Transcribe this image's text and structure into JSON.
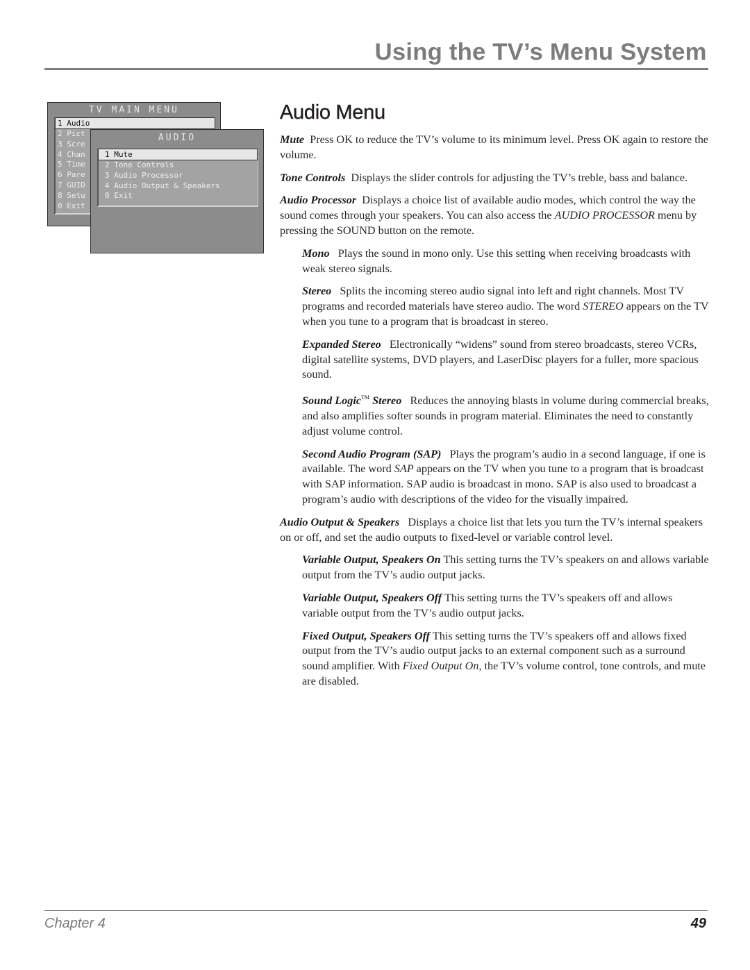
{
  "header": {
    "title": "Using the TV’s Menu System"
  },
  "tv_menu": {
    "main_menu": {
      "title": "TV MAIN MENU",
      "items": [
        "1 Audio",
        "2 Pict",
        "3 Scre",
        "4 Chan",
        "5 Time",
        "6 Pare",
        "7 GUID",
        "8 Setu",
        "0 Exit"
      ],
      "selected_index": 0
    },
    "audio_menu": {
      "title": "AUDIO",
      "items": [
        "1 Mute",
        "2 Tone Controls",
        "3 Audio Processor",
        "4 Audio Output & Speakers",
        "0 Exit"
      ],
      "selected_index": 0
    }
  },
  "section": {
    "title": "Audio Menu",
    "paragraphs": [
      {
        "term": "Mute",
        "text": "Press OK to reduce the TV’s volume to its minimum level. Press OK again to restore the volume."
      },
      {
        "term": "Tone Controls",
        "text": "Displays the slider controls for adjusting the TV’s treble, bass and balance."
      },
      {
        "term": "Audio Processor",
        "text_before": "Displays a choice list of available audio modes, which control the way the sound comes through your speakers. You can also access the ",
        "italic": "AUDIO PROCESSOR",
        "text_after": " menu by pressing the SOUND button on the remote."
      },
      {
        "term": "Mono",
        "text": "Plays the sound in mono only. Use this setting when receiving broadcasts with weak stereo signals."
      },
      {
        "term": "Stereo",
        "text_before": "Splits the incoming stereo audio signal into left and right channels. Most TV programs and recorded materials have stereo audio. The word ",
        "italic": "STEREO",
        "text_after": " appears on the TV when you tune to a program that is broadcast in stereo."
      },
      {
        "term": "Expanded Stereo",
        "text": "Electronically “widens” sound from stereo broadcasts, stereo VCRs, digital satellite systems, DVD players, and LaserDisc players for a fuller, more spacious sound."
      },
      {
        "term_a": "Sound Logic",
        "tm": "TM",
        "term_b": " Stereo",
        "text": "Reduces the annoying blasts in volume during commercial breaks, and also amplifies softer sounds in program material. Eliminates the need to constantly adjust volume control."
      },
      {
        "term": "Second Audio Program (SAP)",
        "text_before": "Plays the program’s audio in a second language, if one is available. The word ",
        "italic": "SAP",
        "text_after": " appears on the TV when you tune to a program that is broadcast with SAP information. SAP audio is broadcast in mono. SAP is also used to broadcast a program’s audio with descriptions of the video for the visually impaired."
      },
      {
        "term": "Audio Output & Speakers",
        "text": "Displays a choice list that lets you turn the TV’s internal speakers on or off, and set the audio outputs to fixed-level or variable control level."
      },
      {
        "term": "Variable Output, Speakers On",
        "text": "This setting turns the TV’s speakers on and allows variable output from the TV’s audio output jacks."
      },
      {
        "term": "Variable Output, Speakers Off",
        "text": "This setting turns the TV’s speakers off and allows variable output from the TV’s audio output jacks."
      },
      {
        "term": "Fixed Output, Speakers Off",
        "text_before": "This setting turns the TV’s speakers off and allows fixed output from the TV’s audio output jacks to an external component such as a surround sound amplifier. With ",
        "italic": "Fixed Output On",
        "text_after": ", the TV’s volume control, tone controls, and mute are disabled."
      }
    ]
  },
  "footer": {
    "chapter": "Chapter 4",
    "page_number": "49"
  }
}
